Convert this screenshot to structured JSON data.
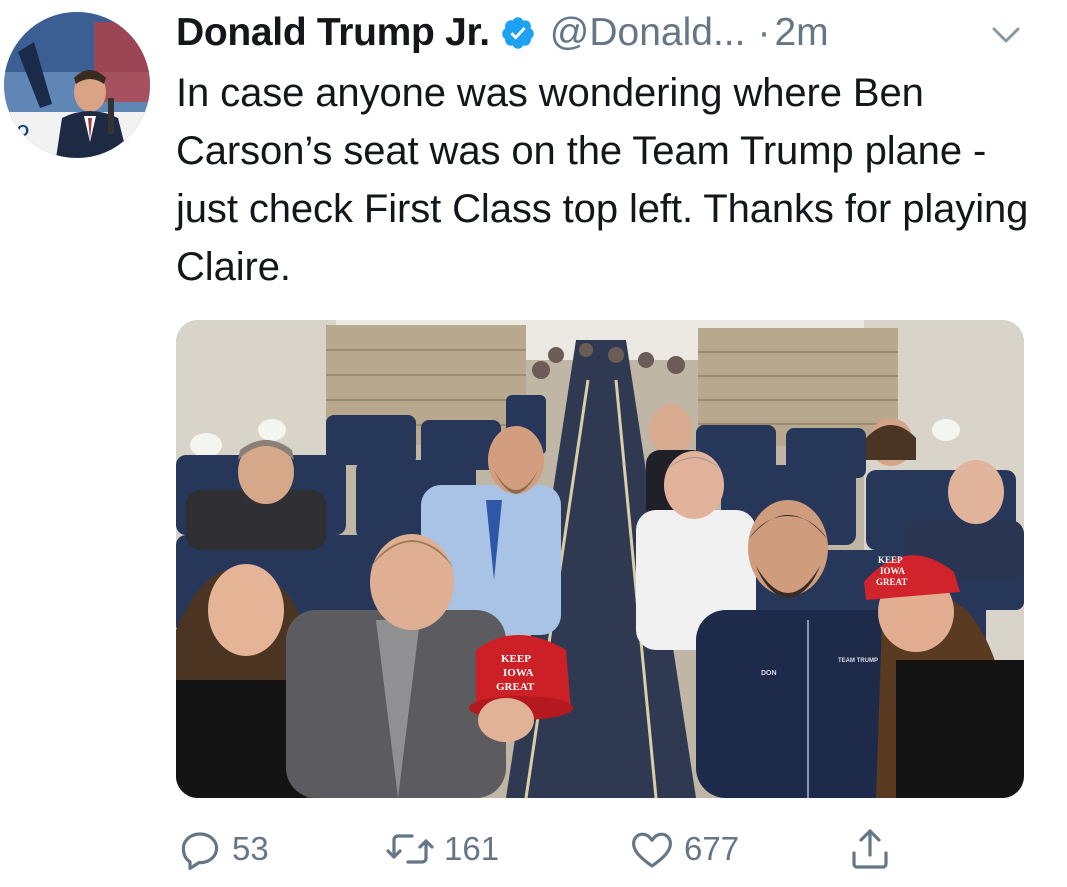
{
  "user": {
    "display_name": "Donald Trump Jr.",
    "handle": "@Donald...",
    "separator": "·",
    "time": "2m",
    "verified": true,
    "avatar_icon": "profile-photo"
  },
  "tweet": {
    "text": "In case anyone was wondering where Ben Carson’s seat was on the Team Trump plane - just check First Class top left. Thanks for playing Claire."
  },
  "media": {
    "kind": "photo",
    "hat_text": "KEEP IOWA GREAT",
    "jacket_text_left": "DON",
    "jacket_text_right": "TEAM TRUMP"
  },
  "actions": {
    "reply": {
      "icon": "reply-icon",
      "count": "53"
    },
    "retweet": {
      "icon": "retweet-icon",
      "count": "161"
    },
    "like": {
      "icon": "heart-icon",
      "count": "677"
    },
    "share": {
      "icon": "share-icon"
    }
  },
  "colors": {
    "text_primary": "#14171a",
    "text_secondary": "#657786",
    "verified_blue": "#1da1f2"
  }
}
